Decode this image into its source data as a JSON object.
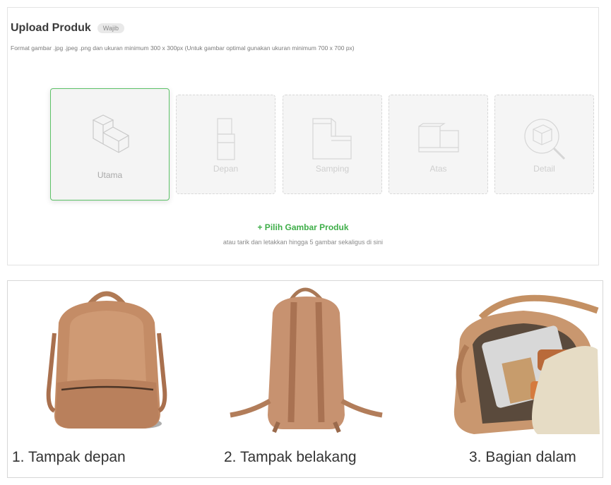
{
  "upload": {
    "title": "Upload Produk",
    "badge": "Wajib",
    "hint": "Format gambar .jpg .jpeg .png dan ukuran minimum 300 x 300px (Untuk gambar optimal gunakan ukuran minimum 700 x 700 px)",
    "slots": [
      {
        "label": "Utama",
        "icon": "box-main-icon",
        "active": true
      },
      {
        "label": "Depan",
        "icon": "box-front-icon",
        "active": false
      },
      {
        "label": "Samping",
        "icon": "box-side-icon",
        "active": false
      },
      {
        "label": "Atas",
        "icon": "box-top-icon",
        "active": false
      },
      {
        "label": "Detail",
        "icon": "magnifier-detail-icon",
        "active": false
      }
    ],
    "pick_button": "+ Pilih Gambar Produk",
    "drop_hint": "atau tarik dan letakkan hingga 5 gambar sekaligus di sini",
    "accent_color": "#3fae49"
  },
  "examples": {
    "items": [
      {
        "caption": "1. Tampak depan",
        "image": "backpack-front-photo"
      },
      {
        "caption": "2. Tampak belakang",
        "image": "backpack-back-photo"
      },
      {
        "caption": "3. Bagian dalam",
        "image": "backpack-inside-photo"
      }
    ]
  }
}
